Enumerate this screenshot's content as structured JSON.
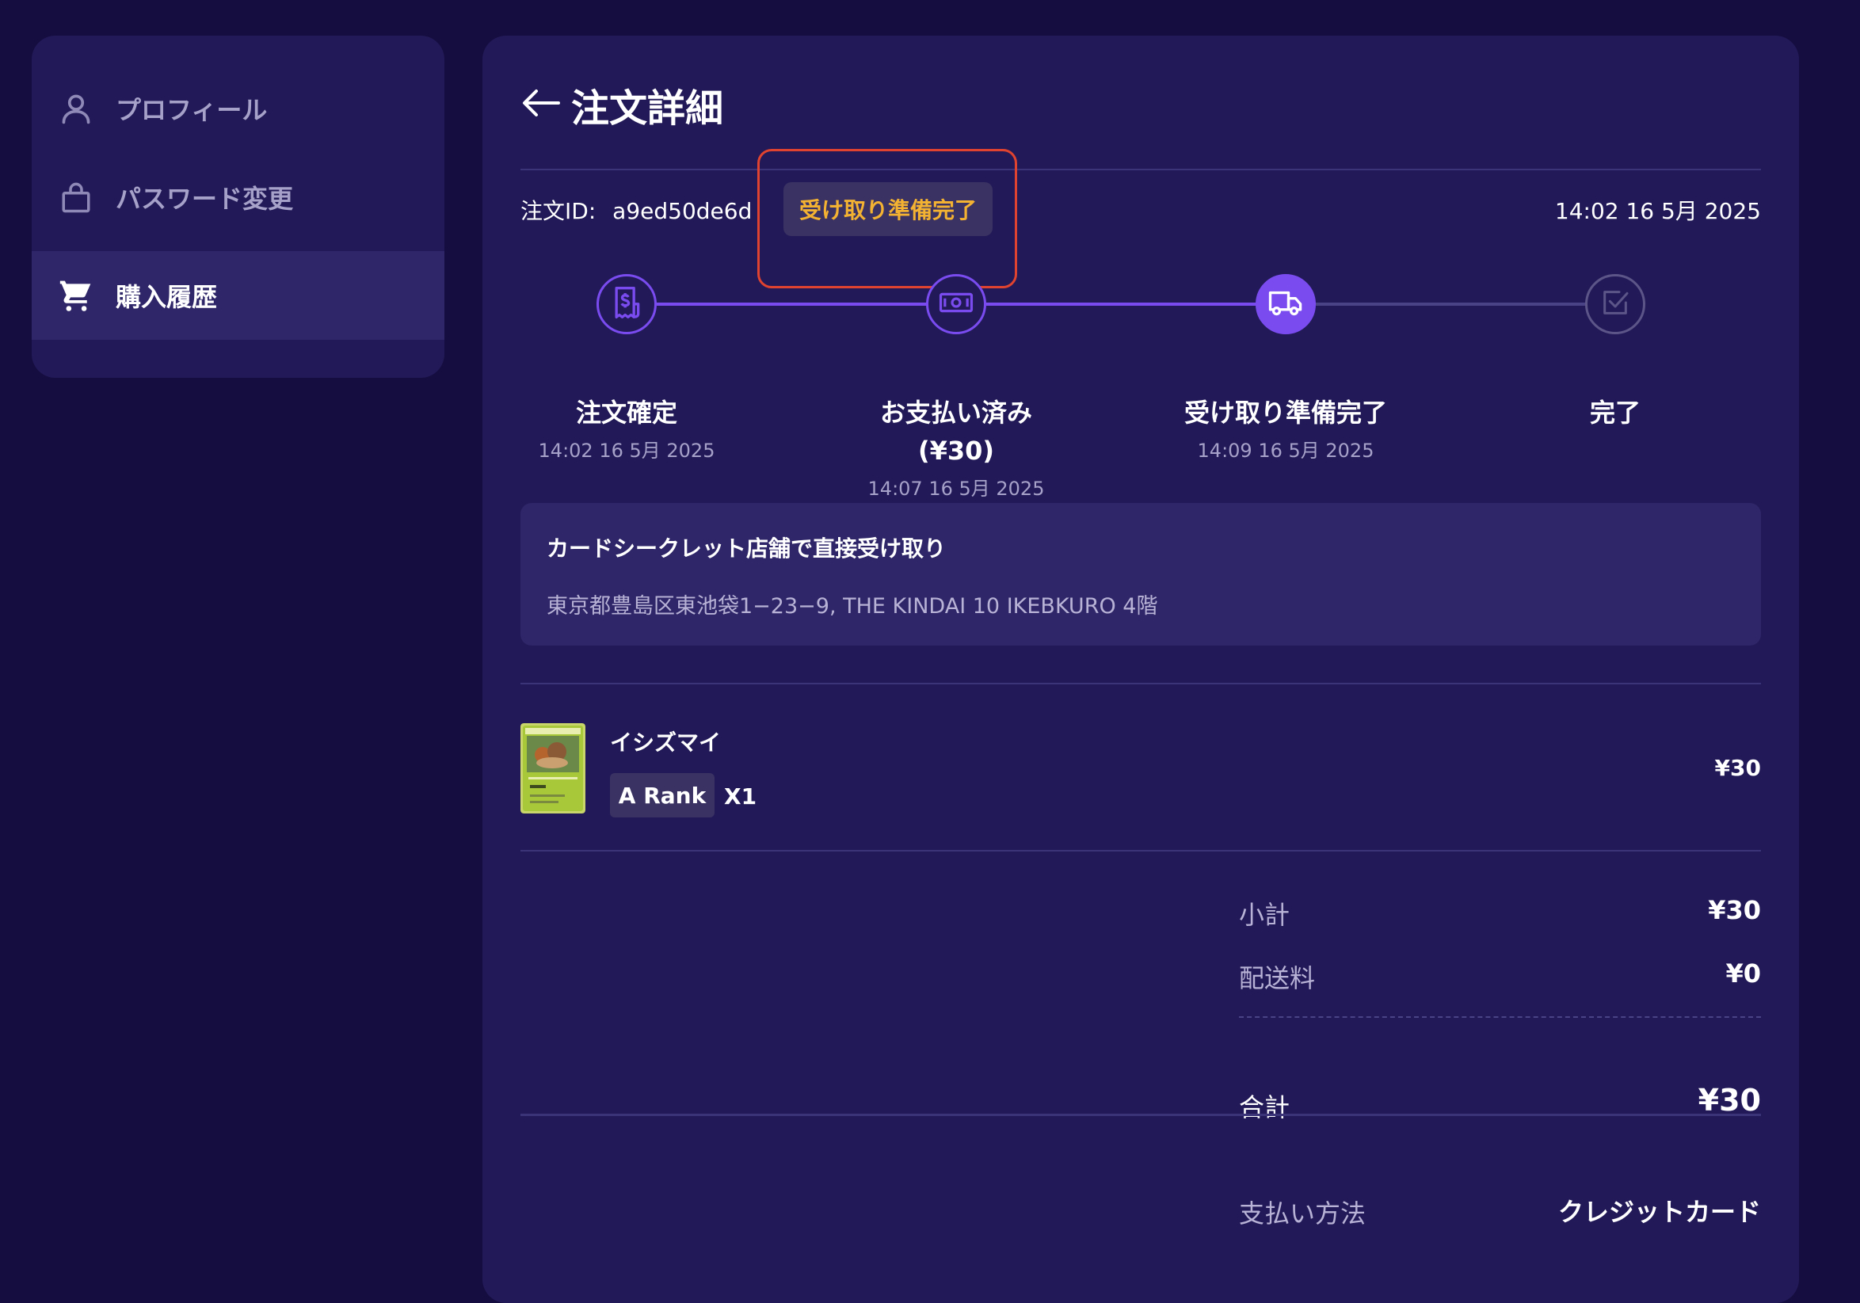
{
  "sidebar": {
    "items": [
      {
        "label": "プロフィール",
        "icon": "user-icon",
        "active": false
      },
      {
        "label": "パスワード変更",
        "icon": "lock-icon",
        "active": false
      },
      {
        "label": "購入履歴",
        "icon": "cart-icon",
        "active": true
      }
    ]
  },
  "header": {
    "back_icon": "arrow-left-icon",
    "title": "注文詳細"
  },
  "order": {
    "id_label": "注文ID:",
    "id": "a9ed50de6d",
    "status": "受け取り準備完了",
    "date": "14:02 16 5月 2025"
  },
  "steps": [
    {
      "label": "注文確定",
      "label2": "",
      "time": "14:02 16 5月 2025",
      "icon": "receipt-icon",
      "state": "done"
    },
    {
      "label": "お支払い済み",
      "label2": "(¥30)",
      "time": "14:07 16 5月 2025",
      "icon": "banknote-icon",
      "state": "done"
    },
    {
      "label": "受け取り準備完了",
      "label2": "",
      "time": "14:09 16 5月 2025",
      "icon": "truck-icon",
      "state": "current"
    },
    {
      "label": "完了",
      "label2": "",
      "time": "",
      "icon": "check-square-icon",
      "state": "pending"
    }
  ],
  "pickup": {
    "title": "カードシークレット店舗で直接受け取り",
    "address": "東京都豊島区東池袋1−23−9, THE KINDAI 10 IKEBKURO 4階"
  },
  "items": [
    {
      "name": "イシズマイ",
      "rank": "A Rank",
      "qty": "X1",
      "price": "¥30"
    }
  ],
  "summary": {
    "subtotal_label": "小計",
    "subtotal": "¥30",
    "shipping_label": "配送料",
    "shipping": "¥0",
    "total_label": "合計",
    "total": "¥30",
    "payment_label": "支払い方法",
    "payment": "クレジットカード"
  },
  "colors": {
    "background": "#150d3f",
    "panel": "#221a58",
    "accent": "#7a4cf0",
    "status_text": "#f4b232",
    "highlight": "#e0432f"
  }
}
